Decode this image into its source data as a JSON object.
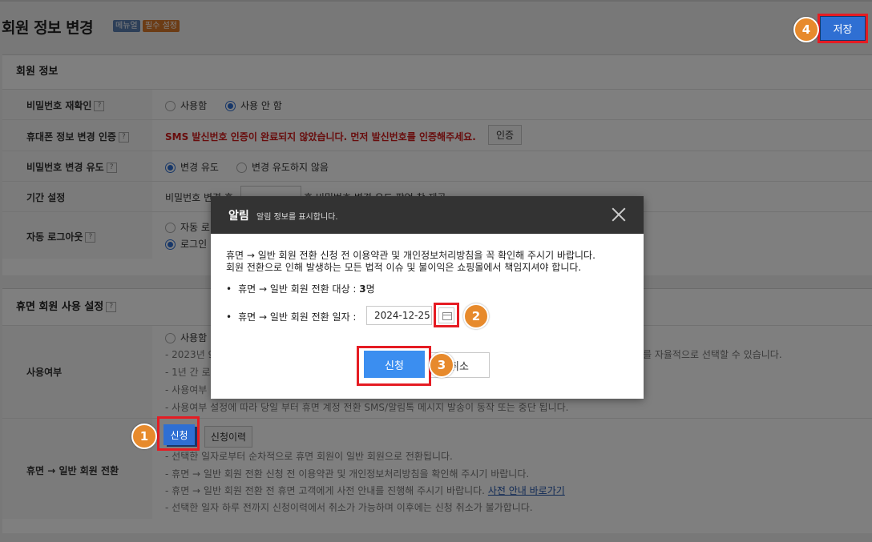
{
  "header": {
    "title": "회원 정보 변경",
    "badge_menu": "메뉴얼",
    "badge_required": "필수 설정",
    "save_label": "저장"
  },
  "steps": [
    "1",
    "2",
    "3",
    "4"
  ],
  "member_info": {
    "title": "회원 정보",
    "password_recheck": {
      "label": "비밀번호 재확인",
      "opt_use": "사용함",
      "opt_nouse": "사용 안 함"
    },
    "phone_verify": {
      "label": "휴대폰 정보 변경 인증",
      "message": "SMS 발신번호 인증이 완료되지 않았습니다. 먼저 발신번호를 인증해주세요.",
      "button": "인증"
    },
    "password_change": {
      "label": "비밀번호 변경 유도",
      "opt_on": "변경 유도",
      "opt_off": "변경 유도하지 않음"
    },
    "period": {
      "label": "기간 설정",
      "text_prefix": "비밀번호 변경 후",
      "text_suffix": "후 비밀번호 변경 유도 팝업 창 제공"
    },
    "auto_logout": {
      "label": "자동 로그아웃",
      "opt1": "자동 로",
      "opt2": "로그인"
    }
  },
  "dormant": {
    "title": "휴면 회원 사용 설정",
    "usage": {
      "label": "사용여부",
      "opt_use": "사용함",
      "note1_left": "2023년 9",
      "note1_right": "를 자율적으로 선택할 수 있습니다.",
      "note2": "1년 간 로",
      "note3": "사용여부",
      "note4": "사용여부 설정에 따라 당일 부터 휴면 계정 전환 SMS/알림톡 메시지 발송이 동작 또는 중단 됩니다."
    },
    "convert": {
      "label": "휴면 → 일반 회원 전환",
      "apply_button": "신청",
      "history_button": "신청이력",
      "note1": "선택한 일자로부터 순차적으로 휴면 회원이 일반 회원으로 전환됩니다.",
      "note2": "휴면 → 일반 회원 전환 신청 전 이용약관 및 개인정보처리방침을 확인해 주시기 바랍니다.",
      "note3": "휴면 → 일반 회원 전환 전 휴면 고객에게 사전 안내를 진행해 주시기 바랍니다.",
      "note3_link": "사전 안내 바로가기",
      "note4": "선택한 일자 하루 전까지 신청이력에서 취소가 가능하며 이후에는 신청 취소가 불가합니다."
    }
  },
  "modal": {
    "title": "알림",
    "subtitle": "알림 정보를 표시합니다.",
    "line1": "휴면 → 일반 회원 전환 신청 전 이용약관 및 개인정보처리방침을 꼭 확인해 주시기 바랍니다.",
    "line2": "회원 전환으로 인해 발생하는 모든 법적 이슈 및 불이익은 쇼핑몰에서 책임지셔야 합니다.",
    "target_label": "휴면 → 일반 회원 전환 대상 : ",
    "target_count": "3",
    "target_unit": "명",
    "date_label": "휴면 → 일반 회원 전환 일자 :",
    "date_value": "2024-12-25",
    "apply": "신청",
    "cancel": "취소"
  }
}
